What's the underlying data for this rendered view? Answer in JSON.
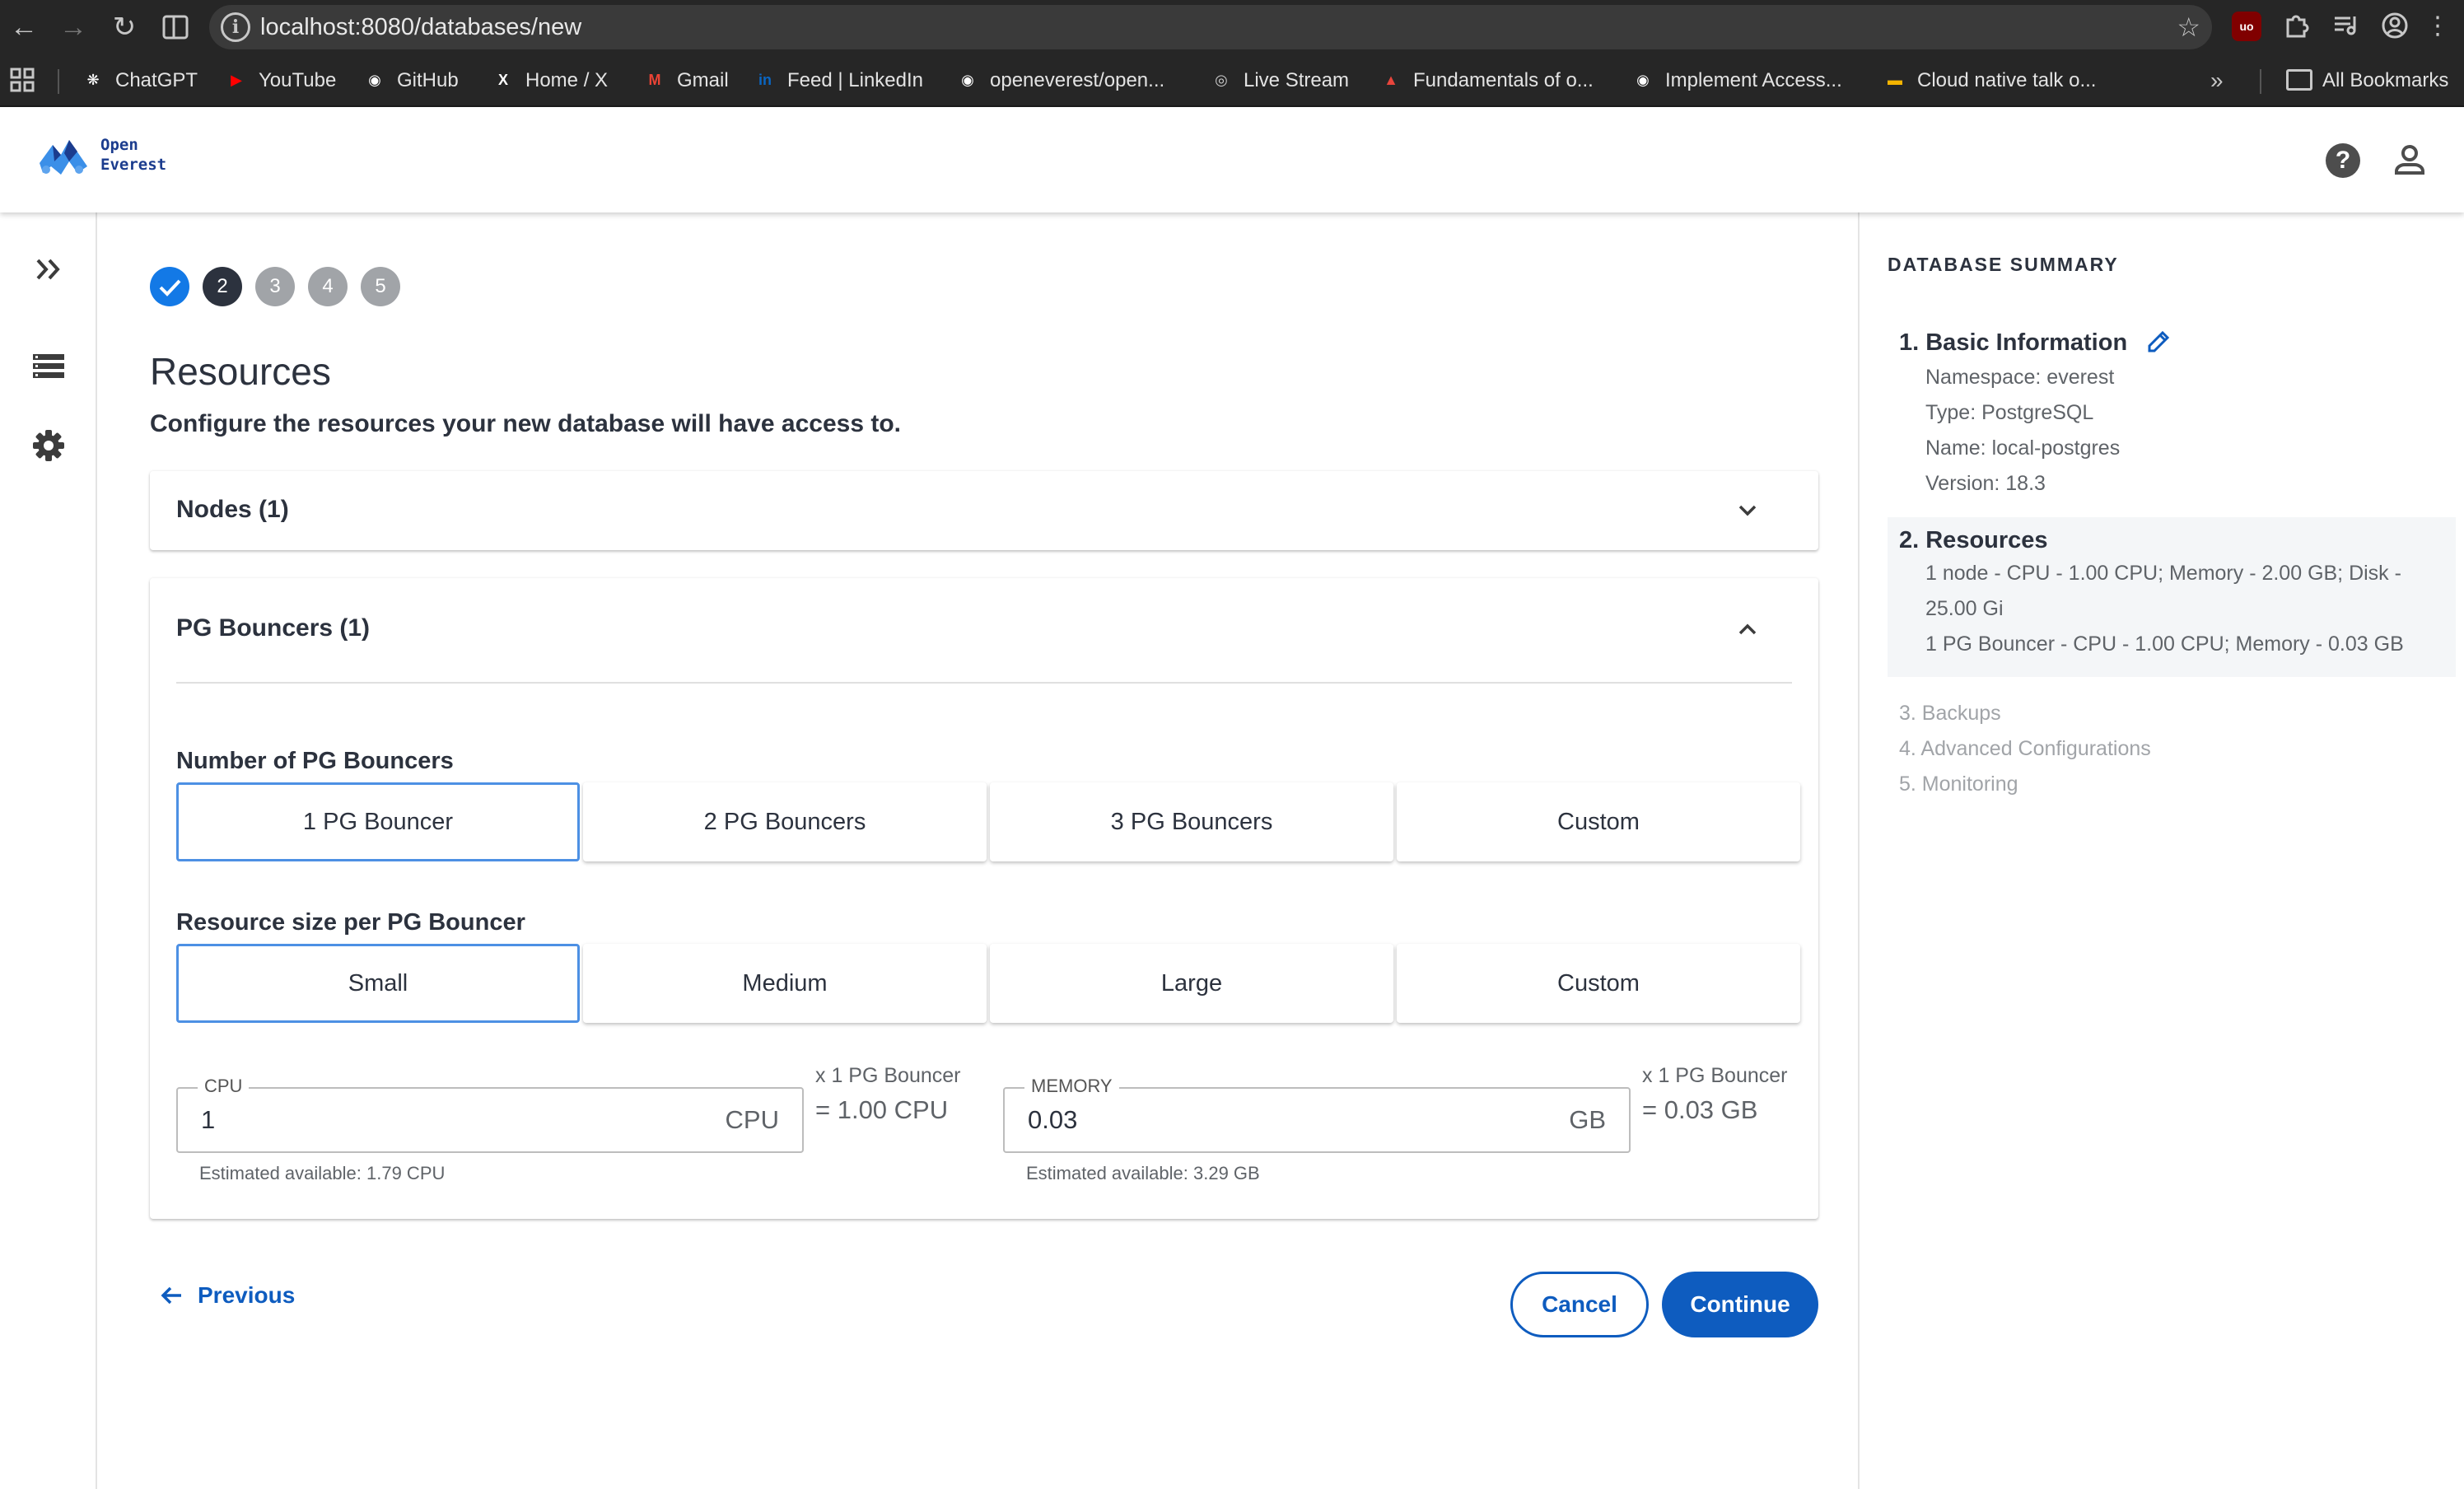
{
  "browser": {
    "url": "localhost:8080/databases/new",
    "bookmarks": [
      {
        "label": "ChatGPT",
        "icon": "chatgpt-icon",
        "color": "#ffffff"
      },
      {
        "label": "YouTube",
        "icon": "youtube-icon",
        "color": "#ff0000"
      },
      {
        "label": "GitHub",
        "icon": "github-icon",
        "color": "#ffffff"
      },
      {
        "label": "Home / X",
        "icon": "x-icon",
        "color": "#ffffff"
      },
      {
        "label": "Gmail",
        "icon": "gmail-icon",
        "color": "#ea4335"
      },
      {
        "label": "Feed | LinkedIn",
        "icon": "linkedin-icon",
        "color": "#0a66c2"
      },
      {
        "label": "openeverest/open...",
        "icon": "github-icon",
        "color": "#ffffff"
      },
      {
        "label": "Live Stream",
        "icon": "globe-icon",
        "color": "#cccccc"
      },
      {
        "label": "Fundamentals of o...",
        "icon": "fire-icon",
        "color": "#e8453c"
      },
      {
        "label": "Implement Access...",
        "icon": "github-icon",
        "color": "#ffffff"
      },
      {
        "label": "Cloud native talk o...",
        "icon": "slides-icon",
        "color": "#f4b400"
      }
    ],
    "all_bookmarks": "All Bookmarks"
  },
  "app": {
    "logo_line1": "Open",
    "logo_line2": "Everest"
  },
  "wizard": {
    "steps": [
      {
        "label": "",
        "state": "done"
      },
      {
        "label": "2",
        "state": "active"
      },
      {
        "label": "3",
        "state": "todo"
      },
      {
        "label": "4",
        "state": "todo"
      },
      {
        "label": "5",
        "state": "todo"
      }
    ],
    "title": "Resources",
    "subtitle": "Configure the resources your new database will have access to."
  },
  "nodes_panel": {
    "title": "Nodes (1)",
    "expanded": false
  },
  "bouncers_panel": {
    "title": "PG Bouncers (1)",
    "expanded": true,
    "count_label": "Number of PG Bouncers",
    "count_options": [
      "1 PG Bouncer",
      "2 PG Bouncers",
      "3 PG Bouncers",
      "Custom"
    ],
    "count_selected": 0,
    "size_label": "Resource size per PG Bouncer",
    "size_options": [
      "Small",
      "Medium",
      "Large",
      "Custom"
    ],
    "size_selected": 0,
    "cpu": {
      "label": "CPU",
      "value": "1",
      "unit": "CPU",
      "helper": "Estimated available: 1.79 CPU",
      "multiplier": "x 1 PG Bouncer",
      "total": "= 1.00 CPU"
    },
    "memory": {
      "label": "MEMORY",
      "value": "0.03",
      "unit": "GB",
      "helper": "Estimated available: 3.29 GB",
      "multiplier": "x 1 PG Bouncer",
      "total": "= 0.03 GB"
    }
  },
  "actions": {
    "previous": "Previous",
    "cancel": "Cancel",
    "continue": "Continue"
  },
  "summary": {
    "title": "DATABASE SUMMARY",
    "basic": {
      "title": "1. Basic Information",
      "lines": [
        "Namespace: everest",
        "Type: PostgreSQL",
        "Name: local-postgres",
        "Version: 18.3"
      ]
    },
    "resources": {
      "title": "2. Resources",
      "lines": [
        "1 node - CPU - 1.00 CPU; Memory - 2.00 GB; Disk -",
        "25.00 Gi",
        "1 PG Bouncer - CPU - 1.00 CPU; Memory - 0.03 GB"
      ]
    },
    "pending": [
      "3. Backups",
      "4. Advanced Configurations",
      "5. Monitoring"
    ]
  },
  "colors": {
    "primary": "#0e5cbf",
    "step_done": "#1379e6",
    "step_active": "#2c323e",
    "step_todo": "#a1a4a8",
    "selected_border": "#4d90e4"
  }
}
